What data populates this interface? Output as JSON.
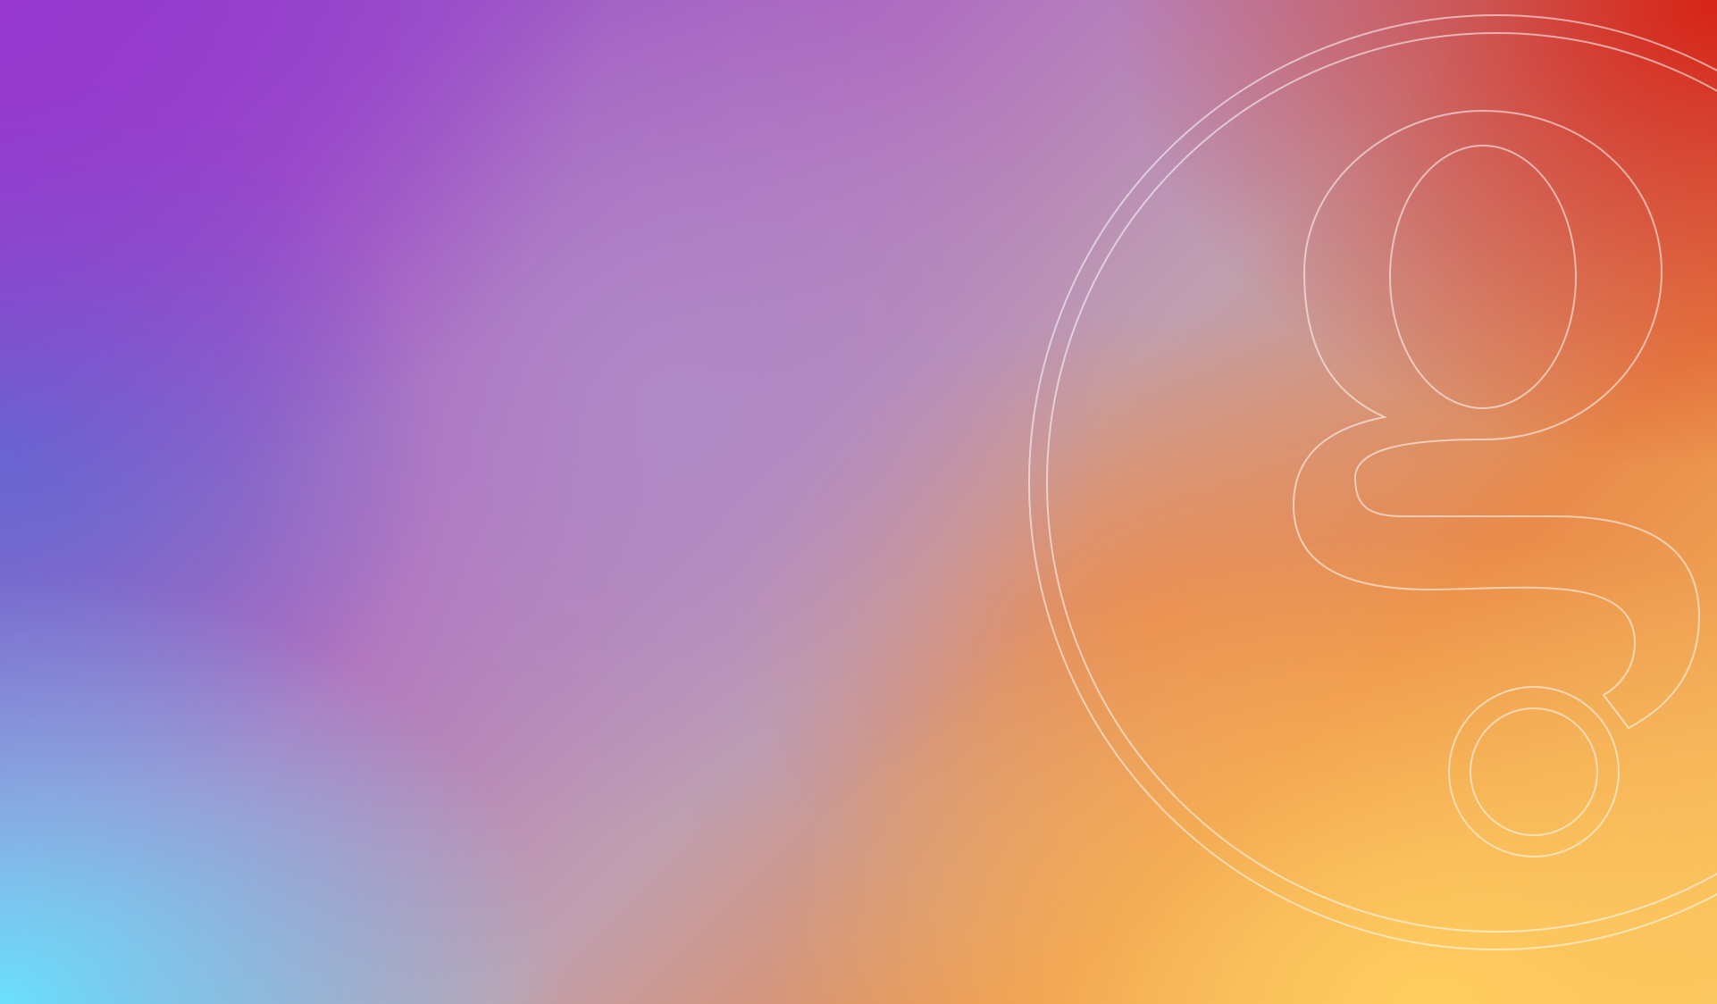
{
  "desktop": {
    "wallpaper": {
      "logo_icon": "giphy-g-outline-icon",
      "colors": {
        "top_left": "#9637cd",
        "top_right": "#d62316",
        "bottom_left": "#6ae0fc",
        "bottom_right": "#ffcd5f",
        "logo_stroke": "#ffffff"
      }
    }
  }
}
